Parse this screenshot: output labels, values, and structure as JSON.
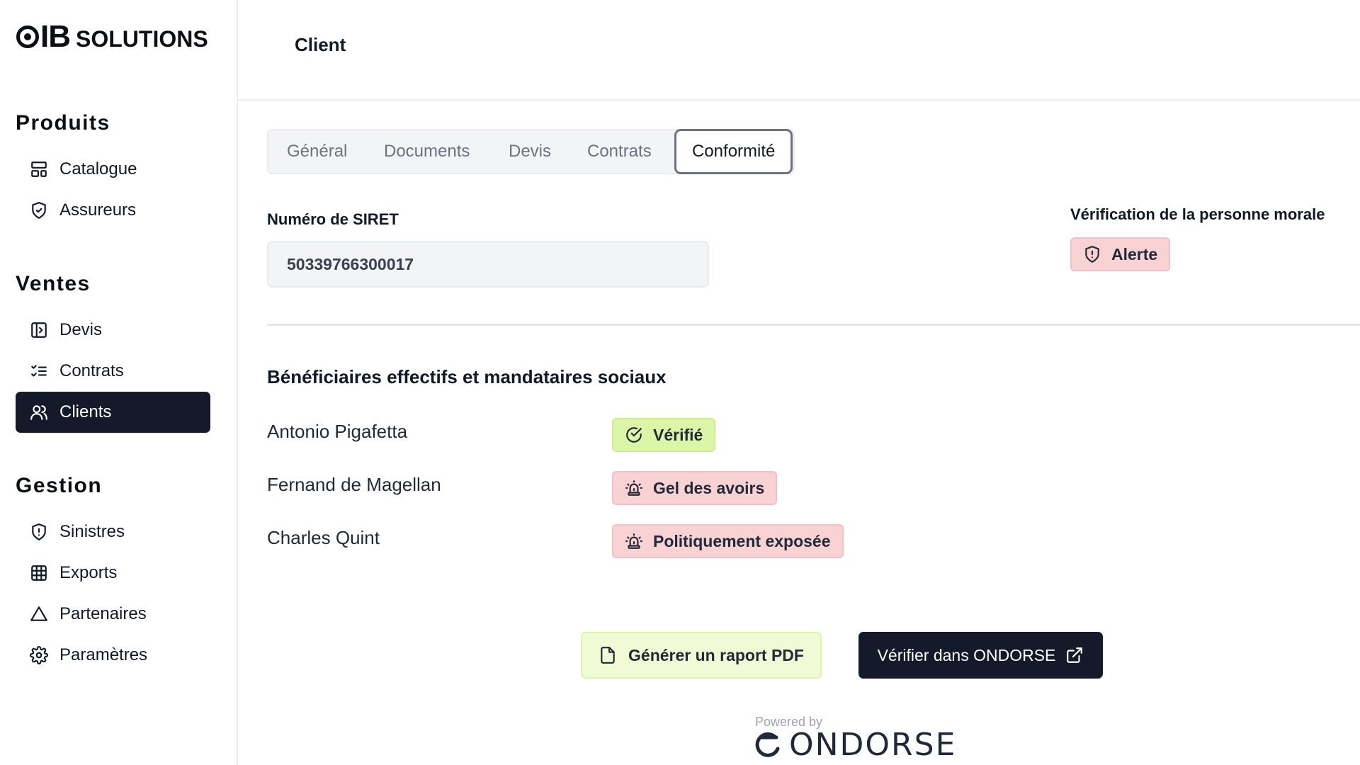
{
  "brand": {
    "mark": "O",
    "ib": "IB",
    "solutions": "SOLUTIONS"
  },
  "sidebar": {
    "sections": [
      {
        "title": "Produits",
        "items": [
          {
            "label": "Catalogue",
            "icon": "layout-icon"
          },
          {
            "label": "Assureurs",
            "icon": "shield-check-icon"
          }
        ]
      },
      {
        "title": "Ventes",
        "items": [
          {
            "label": "Devis",
            "icon": "file-input-icon"
          },
          {
            "label": "Contrats",
            "icon": "list-checks-icon"
          },
          {
            "label": "Clients",
            "icon": "users-icon",
            "active": true
          }
        ]
      },
      {
        "title": "Gestion",
        "items": [
          {
            "label": "Sinistres",
            "icon": "shield-alert-icon"
          },
          {
            "label": "Exports",
            "icon": "grid-icon"
          },
          {
            "label": "Partenaires",
            "icon": "triangle-icon"
          },
          {
            "label": "Paramètres",
            "icon": "settings-icon"
          }
        ]
      }
    ]
  },
  "header": {
    "title": "Client"
  },
  "tabs": [
    {
      "label": "Général"
    },
    {
      "label": "Documents"
    },
    {
      "label": "Devis"
    },
    {
      "label": "Contrats"
    },
    {
      "label": "Conformité",
      "active": true
    }
  ],
  "siret": {
    "label": "Numéro de SIRET",
    "value": "50339766300017"
  },
  "verification": {
    "label": "Vérification de la personne morale",
    "status": "Alerte"
  },
  "beneficiaries": {
    "title": "Bénéficiaires effectifs et mandataires sociaux",
    "rows": [
      {
        "name": "Antonio Pigafetta",
        "status": "Vérifié",
        "tone": "green"
      },
      {
        "name": "Fernand de Magellan",
        "status": "Gel des avoirs",
        "tone": "red"
      },
      {
        "name": "Charles Quint",
        "status": "Politiquement exposée",
        "tone": "red"
      }
    ]
  },
  "actions": {
    "pdf": "Générer un raport PDF",
    "verify": "Vérifier dans ONDORSE"
  },
  "footer": {
    "powered_by": "Powered by",
    "brand": "ONDORSE"
  },
  "colors": {
    "primary_dark": "#141a2a",
    "alert_bg": "#f9d2d4",
    "success_bg": "#dcf6a8",
    "pdf_bg": "#f0fbd6"
  }
}
